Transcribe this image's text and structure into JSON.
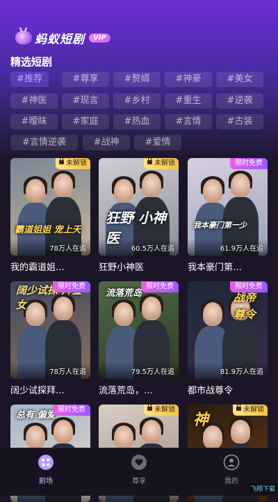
{
  "app": {
    "name": "蚂蚁短剧",
    "vip_badge": "VIP"
  },
  "section_title": "精选短剧",
  "tags": [
    "#推荐",
    "#尊享",
    "#赘婿",
    "#神豪",
    "#美女",
    "#神医",
    "#现言",
    "#乡村",
    "#重生",
    "#逆袭",
    "#暧昧",
    "#家庭",
    "#热血",
    "#言情",
    "#古装",
    "#言情逆袭",
    "#战神",
    "#爱情"
  ],
  "active_tag": "#推荐",
  "badges": {
    "locked": "未解锁",
    "free": "限时免费"
  },
  "dramas": [
    {
      "title": "我的霸道姐…",
      "views": "78万人在追",
      "badge": "locked",
      "poster_text": "霸道姐姐 宠上天",
      "colors": [
        "#7a8796",
        "#c9b39a"
      ]
    },
    {
      "title": "狂野小神医",
      "views": "60.5万人在追",
      "badge": "locked",
      "poster_text": "狂野 小神医",
      "colors": [
        "#cfcfd4",
        "#8b8f99"
      ]
    },
    {
      "title": "我本豪门第…",
      "views": "61.9万人在追",
      "badge": "free",
      "poster_text": "我本豪门第一少",
      "colors": [
        "#d8cfe0",
        "#9aa4b8"
      ]
    },
    {
      "title": "阔少试探拜…",
      "views": "78万人在追",
      "badge": "free",
      "poster_text": "阔少试探 拜金女",
      "colors": [
        "#3f4a63",
        "#8d6e5a"
      ]
    },
    {
      "title": "流落荒岛，…",
      "views": "79.5万人在追",
      "badge": "free",
      "poster_text": "流落荒岛",
      "colors": [
        "#4f6b45",
        "#2f3b2a"
      ]
    },
    {
      "title": "都市战尊令",
      "views": "81.9万人在追",
      "badge": "free",
      "poster_text": "战帝 尊令",
      "colors": [
        "#1d2a3a",
        "#3a2a4a"
      ]
    },
    {
      "title": "",
      "views": "",
      "badge": "free",
      "poster_text": "总有 偏爱",
      "colors": [
        "#a7b6cc",
        "#e6d7c9"
      ]
    },
    {
      "title": "",
      "views": "",
      "badge": "locked",
      "poster_text": "",
      "colors": [
        "#d9cfc6",
        "#9d8a7e"
      ]
    },
    {
      "title": "",
      "views": "",
      "badge": "locked",
      "poster_text": "神",
      "colors": [
        "#2a1e12",
        "#6b3a16"
      ]
    }
  ],
  "tabbar": [
    {
      "label": "剧场",
      "icon": "theater-icon"
    },
    {
      "label": "尊享",
      "icon": "heart-icon"
    },
    {
      "label": "我的",
      "icon": "profile-icon"
    }
  ],
  "active_tab": "剧场",
  "watermark": "飞翔下载"
}
